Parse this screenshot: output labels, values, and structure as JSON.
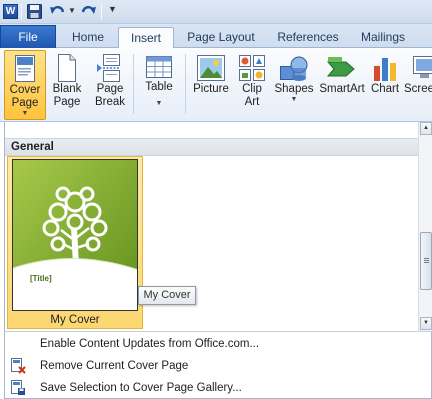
{
  "quick_access": {
    "app_icon_letter": "W",
    "icons": [
      "word-app-icon",
      "save-icon",
      "undo-icon",
      "redo-icon",
      "customize-qat-icon"
    ]
  },
  "tabs": [
    {
      "label": "File"
    },
    {
      "label": "Home"
    },
    {
      "label": "Insert"
    },
    {
      "label": "Page Layout"
    },
    {
      "label": "References"
    },
    {
      "label": "Mailings"
    }
  ],
  "ribbon": {
    "cover_page": {
      "line1": "Cover",
      "line2": "Page"
    },
    "blank_page": {
      "line1": "Blank",
      "line2": "Page"
    },
    "page_break": {
      "line1": "Page",
      "line2": "Break"
    },
    "table": {
      "line1": "Table"
    },
    "picture": {
      "line1": "Picture"
    },
    "clip_art": {
      "line1": "Clip",
      "line2": "Art"
    },
    "shapes": {
      "line1": "Shapes"
    },
    "smartart": {
      "line1": "SmartArt"
    },
    "chart": {
      "line1": "Chart"
    },
    "screenshot": {
      "line1": "Screenshot"
    }
  },
  "gallery": {
    "section_title": "General",
    "items": [
      {
        "caption": "My Cover",
        "thumbnail_text": "[Title]"
      }
    ],
    "tooltip": "My Cover"
  },
  "menu": {
    "enable_updates": "Enable Content Updates from Office.com...",
    "remove_cover": "Remove Current Cover Page",
    "save_selection": "Save Selection to Cover Page Gallery..."
  },
  "colors": {
    "file_tab": "#2a66c0",
    "selected_item": "#fcd771",
    "cover_green": "#8cb433"
  }
}
